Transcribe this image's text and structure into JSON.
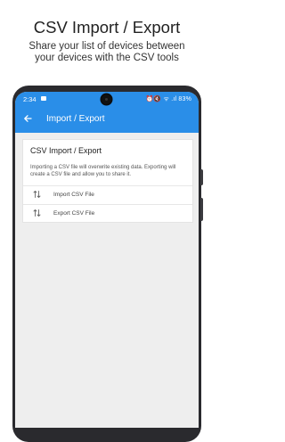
{
  "promo": {
    "title": "CSV Import / Export",
    "subtitle_line1": "Share your list of devices between",
    "subtitle_line2": "your devices with the CSV tools"
  },
  "status_bar": {
    "time": "2:34",
    "icons_text": "⏰🔇 ᯤ .ıl 83%",
    "battery": "83%"
  },
  "app_bar": {
    "back_icon": "arrow-back-icon",
    "title": "Import / Export"
  },
  "card": {
    "title": "CSV Import / Export",
    "description": "Importing a CSV file will overwrite existing data. Exporting will create a CSV file and allow you to share it.",
    "actions": [
      {
        "icon": "import-export-icon",
        "label": "Import CSV File"
      },
      {
        "icon": "import-export-icon",
        "label": "Export CSV File"
      }
    ]
  },
  "colors": {
    "accent": "#2a8ee8",
    "background": "#eeeeee"
  }
}
